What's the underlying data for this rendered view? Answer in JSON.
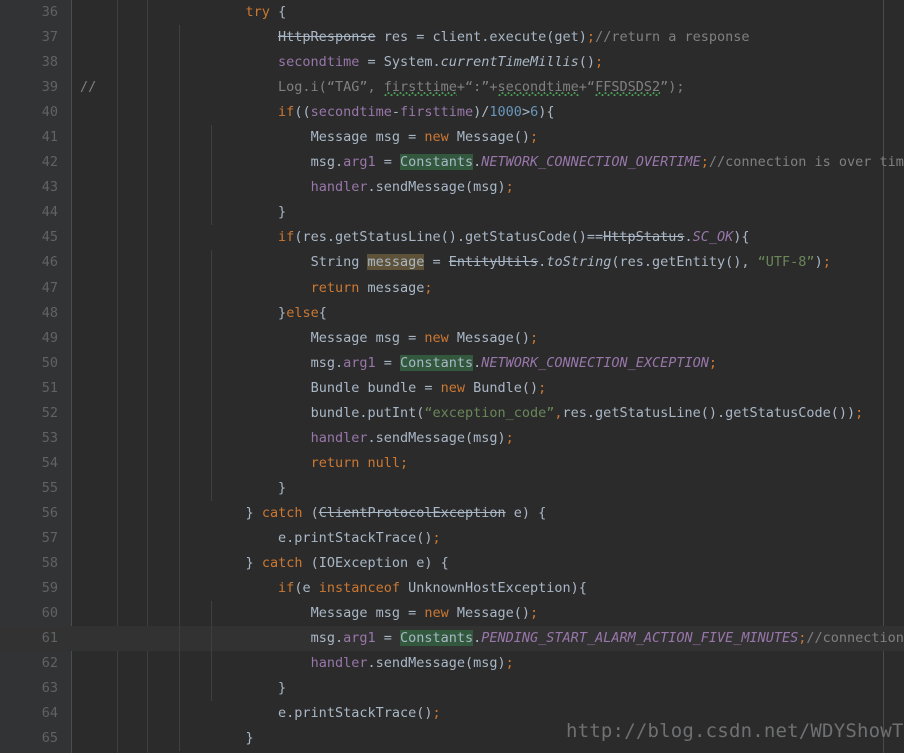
{
  "editor": {
    "theme": "darcula",
    "background": "#2b2b2b",
    "gutter_background": "#313335",
    "current_line_background": "#323232",
    "default_text_color": "#a9b7c6",
    "keyword_color": "#cc7832",
    "string_color": "#6a8759",
    "number_color": "#6897bb",
    "comment_color": "#808080",
    "field_color": "#9876aa",
    "line_number_color": "#606366",
    "find_highlight_color": "#32593d",
    "identifier_highlight_color": "#5e5339",
    "typo_underline_color": "#499c54",
    "current_line_number": 61,
    "language": "Java"
  },
  "watermark": {
    "text": "http://blog.csdn.net/WDYShowTime",
    "color": "#6f7072"
  },
  "lines": [
    {
      "n": "36",
      "gutter_mark": "",
      "indent_guides": [],
      "tokens": [
        {
          "t": "            ",
          "c": "plain"
        },
        {
          "t": "try",
          "c": "kw"
        },
        {
          "t": " {",
          "c": "plain"
        }
      ]
    },
    {
      "n": "37",
      "gutter_mark": "",
      "indent_guides": [
        0
      ],
      "tokens": [
        {
          "t": "                ",
          "c": "plain"
        },
        {
          "t": "HttpResponse",
          "c": "depr"
        },
        {
          "t": " res = client.execute(get)",
          "c": "plain"
        },
        {
          "t": ";",
          "c": "kw"
        },
        {
          "t": "//return a response",
          "c": "cmt"
        }
      ]
    },
    {
      "n": "38",
      "gutter_mark": "",
      "indent_guides": [
        0
      ],
      "tokens": [
        {
          "t": "                ",
          "c": "plain"
        },
        {
          "t": "secondtime",
          "c": "field"
        },
        {
          "t": " = System.",
          "c": "plain"
        },
        {
          "t": "currentTimeMillis",
          "c": "smeth"
        },
        {
          "t": "()",
          "c": "plain"
        },
        {
          "t": ";",
          "c": "kw"
        }
      ]
    },
    {
      "n": "39",
      "gutter_mark": "//",
      "indent_guides": [
        0
      ],
      "tokens": [
        {
          "t": "                ",
          "c": "plain"
        },
        {
          "t": "Log.i(“TAG”, ",
          "c": "cmt"
        },
        {
          "t": "firsttime",
          "c": "cmt typo"
        },
        {
          "t": "+“:”+",
          "c": "cmt"
        },
        {
          "t": "secondtime",
          "c": "cmt typo"
        },
        {
          "t": "+“",
          "c": "cmt"
        },
        {
          "t": "FFSDSDS2",
          "c": "cmt typo"
        },
        {
          "t": "”);",
          "c": "cmt"
        }
      ]
    },
    {
      "n": "40",
      "gutter_mark": "",
      "indent_guides": [
        0
      ],
      "tokens": [
        {
          "t": "                ",
          "c": "plain"
        },
        {
          "t": "if",
          "c": "kw"
        },
        {
          "t": "((",
          "c": "plain"
        },
        {
          "t": "secondtime",
          "c": "field"
        },
        {
          "t": "-",
          "c": "plain"
        },
        {
          "t": "firsttime",
          "c": "field"
        },
        {
          "t": ")/",
          "c": "plain"
        },
        {
          "t": "1000",
          "c": "num"
        },
        {
          "t": ">",
          "c": "plain"
        },
        {
          "t": "6",
          "c": "num"
        },
        {
          "t": "){",
          "c": "plain"
        }
      ]
    },
    {
      "n": "41",
      "gutter_mark": "",
      "indent_guides": [
        0,
        1
      ],
      "tokens": [
        {
          "t": "                    ",
          "c": "plain"
        },
        {
          "t": "Message msg = ",
          "c": "plain"
        },
        {
          "t": "new",
          "c": "kw"
        },
        {
          "t": " Message()",
          "c": "plain"
        },
        {
          "t": ";",
          "c": "kw"
        }
      ]
    },
    {
      "n": "42",
      "gutter_mark": "",
      "indent_guides": [
        0,
        1
      ],
      "tokens": [
        {
          "t": "                    ",
          "c": "plain"
        },
        {
          "t": "msg.",
          "c": "plain"
        },
        {
          "t": "arg1",
          "c": "field"
        },
        {
          "t": " = ",
          "c": "plain"
        },
        {
          "t": "Constants",
          "c": "plain hl-find"
        },
        {
          "t": ".",
          "c": "plain"
        },
        {
          "t": "NETWORK_CONNECTION_OVERTIME",
          "c": "cfield"
        },
        {
          "t": ";",
          "c": "kw"
        },
        {
          "t": "//connection is over time",
          "c": "cmt"
        }
      ]
    },
    {
      "n": "43",
      "gutter_mark": "",
      "indent_guides": [
        0,
        1
      ],
      "tokens": [
        {
          "t": "                    ",
          "c": "plain"
        },
        {
          "t": "handler",
          "c": "field"
        },
        {
          "t": ".sendMessage(msg)",
          "c": "plain"
        },
        {
          "t": ";",
          "c": "kw"
        }
      ]
    },
    {
      "n": "44",
      "gutter_mark": "",
      "indent_guides": [
        0,
        1
      ],
      "tokens": [
        {
          "t": "                ",
          "c": "plain"
        },
        {
          "t": "}",
          "c": "plain"
        }
      ]
    },
    {
      "n": "45",
      "gutter_mark": "",
      "indent_guides": [
        0
      ],
      "tokens": [
        {
          "t": "                ",
          "c": "plain"
        },
        {
          "t": "if",
          "c": "kw"
        },
        {
          "t": "(res.getStatusLine().getStatusCode()==",
          "c": "plain"
        },
        {
          "t": "HttpStatus",
          "c": "depr"
        },
        {
          "t": ".",
          "c": "plain"
        },
        {
          "t": "SC_OK",
          "c": "cfield"
        },
        {
          "t": "){",
          "c": "plain"
        }
      ]
    },
    {
      "n": "46",
      "gutter_mark": "",
      "indent_guides": [
        0,
        1
      ],
      "tokens": [
        {
          "t": "                    ",
          "c": "plain"
        },
        {
          "t": "String ",
          "c": "plain"
        },
        {
          "t": "message",
          "c": "plain hl-ident"
        },
        {
          "t": " = ",
          "c": "plain"
        },
        {
          "t": "EntityUtils",
          "c": "depr"
        },
        {
          "t": ".",
          "c": "plain"
        },
        {
          "t": "toString",
          "c": "smeth"
        },
        {
          "t": "(res.getEntity(), ",
          "c": "plain"
        },
        {
          "t": "“UTF-8”",
          "c": "str"
        },
        {
          "t": ")",
          "c": "plain"
        },
        {
          "t": ";",
          "c": "kw"
        }
      ]
    },
    {
      "n": "47",
      "gutter_mark": "",
      "indent_guides": [
        0,
        1
      ],
      "tokens": [
        {
          "t": "                    ",
          "c": "plain"
        },
        {
          "t": "return",
          "c": "kw"
        },
        {
          "t": " message",
          "c": "plain"
        },
        {
          "t": ";",
          "c": "kw"
        }
      ]
    },
    {
      "n": "48",
      "gutter_mark": "",
      "indent_guides": [
        0,
        1
      ],
      "tokens": [
        {
          "t": "                ",
          "c": "plain"
        },
        {
          "t": "}",
          "c": "plain"
        },
        {
          "t": "else",
          "c": "kw"
        },
        {
          "t": "{",
          "c": "plain"
        }
      ]
    },
    {
      "n": "49",
      "gutter_mark": "",
      "indent_guides": [
        0,
        1
      ],
      "tokens": [
        {
          "t": "                    ",
          "c": "plain"
        },
        {
          "t": "Message msg = ",
          "c": "plain"
        },
        {
          "t": "new",
          "c": "kw"
        },
        {
          "t": " Message()",
          "c": "plain"
        },
        {
          "t": ";",
          "c": "kw"
        }
      ]
    },
    {
      "n": "50",
      "gutter_mark": "",
      "indent_guides": [
        0,
        1
      ],
      "tokens": [
        {
          "t": "                    ",
          "c": "plain"
        },
        {
          "t": "msg.",
          "c": "plain"
        },
        {
          "t": "arg1",
          "c": "field"
        },
        {
          "t": " = ",
          "c": "plain"
        },
        {
          "t": "Constants",
          "c": "plain hl-find"
        },
        {
          "t": ".",
          "c": "plain"
        },
        {
          "t": "NETWORK_CONNECTION_EXCEPTION",
          "c": "cfield"
        },
        {
          "t": ";",
          "c": "kw"
        }
      ]
    },
    {
      "n": "51",
      "gutter_mark": "",
      "indent_guides": [
        0,
        1
      ],
      "tokens": [
        {
          "t": "                    ",
          "c": "plain"
        },
        {
          "t": "Bundle bundle = ",
          "c": "plain"
        },
        {
          "t": "new",
          "c": "kw"
        },
        {
          "t": " Bundle()",
          "c": "plain"
        },
        {
          "t": ";",
          "c": "kw"
        }
      ]
    },
    {
      "n": "52",
      "gutter_mark": "",
      "indent_guides": [
        0,
        1
      ],
      "tokens": [
        {
          "t": "                    ",
          "c": "plain"
        },
        {
          "t": "bundle.putInt(",
          "c": "plain"
        },
        {
          "t": "“exception_code”",
          "c": "str"
        },
        {
          "t": ",",
          "c": "kw"
        },
        {
          "t": "res.getStatusLine().getStatusCode())",
          "c": "plain"
        },
        {
          "t": ";",
          "c": "kw"
        }
      ]
    },
    {
      "n": "53",
      "gutter_mark": "",
      "indent_guides": [
        0,
        1
      ],
      "tokens": [
        {
          "t": "                    ",
          "c": "plain"
        },
        {
          "t": "handler",
          "c": "field"
        },
        {
          "t": ".sendMessage(msg)",
          "c": "plain"
        },
        {
          "t": ";",
          "c": "kw"
        }
      ]
    },
    {
      "n": "54",
      "gutter_mark": "",
      "indent_guides": [
        0,
        1
      ],
      "tokens": [
        {
          "t": "                    ",
          "c": "plain"
        },
        {
          "t": "return",
          "c": "kw"
        },
        {
          "t": " ",
          "c": "plain"
        },
        {
          "t": "null",
          "c": "kw"
        },
        {
          "t": ";",
          "c": "kw"
        }
      ]
    },
    {
      "n": "55",
      "gutter_mark": "",
      "indent_guides": [
        0,
        1
      ],
      "tokens": [
        {
          "t": "                ",
          "c": "plain"
        },
        {
          "t": "}",
          "c": "plain"
        }
      ]
    },
    {
      "n": "56",
      "gutter_mark": "",
      "indent_guides": [
        0
      ],
      "tokens": [
        {
          "t": "            ",
          "c": "plain"
        },
        {
          "t": "}",
          "c": "plain"
        },
        {
          "t": " ",
          "c": "plain"
        },
        {
          "t": "catch",
          "c": "kw"
        },
        {
          "t": " (",
          "c": "plain"
        },
        {
          "t": "ClientProtocolException",
          "c": "depr"
        },
        {
          "t": " e) {",
          "c": "plain"
        }
      ]
    },
    {
      "n": "57",
      "gutter_mark": "",
      "indent_guides": [
        0
      ],
      "tokens": [
        {
          "t": "                ",
          "c": "plain"
        },
        {
          "t": "e.printStackTrace()",
          "c": "plain"
        },
        {
          "t": ";",
          "c": "kw"
        }
      ]
    },
    {
      "n": "58",
      "gutter_mark": "",
      "indent_guides": [
        0
      ],
      "tokens": [
        {
          "t": "            ",
          "c": "plain"
        },
        {
          "t": "}",
          "c": "plain"
        },
        {
          "t": " ",
          "c": "plain"
        },
        {
          "t": "catch",
          "c": "kw"
        },
        {
          "t": " (IOException e) {",
          "c": "plain"
        }
      ]
    },
    {
      "n": "59",
      "gutter_mark": "",
      "indent_guides": [
        0
      ],
      "tokens": [
        {
          "t": "                ",
          "c": "plain"
        },
        {
          "t": "if",
          "c": "kw"
        },
        {
          "t": "(e ",
          "c": "plain"
        },
        {
          "t": "instanceof",
          "c": "kw"
        },
        {
          "t": " UnknownHostException){",
          "c": "plain"
        }
      ]
    },
    {
      "n": "60",
      "gutter_mark": "",
      "indent_guides": [
        0,
        1
      ],
      "tokens": [
        {
          "t": "                    ",
          "c": "plain"
        },
        {
          "t": "Message msg = ",
          "c": "plain"
        },
        {
          "t": "new",
          "c": "kw"
        },
        {
          "t": " Message()",
          "c": "plain"
        },
        {
          "t": ";",
          "c": "kw"
        }
      ]
    },
    {
      "n": "61",
      "gutter_mark": "",
      "current": true,
      "indent_guides": [
        0,
        1
      ],
      "tokens": [
        {
          "t": "                    ",
          "c": "plain"
        },
        {
          "t": "msg.",
          "c": "plain"
        },
        {
          "t": "arg1",
          "c": "field"
        },
        {
          "t": " = ",
          "c": "plain"
        },
        {
          "t": "Constants",
          "c": "plain hl-find"
        },
        {
          "t": ".",
          "c": "plain"
        },
        {
          "t": "PENDING_START_ALARM_ACTION_FIVE_MINUTES",
          "c": "cfield"
        },
        {
          "t": ";",
          "c": "kw"
        },
        {
          "t": "//connection is over time",
          "c": "cmt"
        }
      ]
    },
    {
      "n": "62",
      "gutter_mark": "",
      "indent_guides": [
        0,
        1
      ],
      "tokens": [
        {
          "t": "                    ",
          "c": "plain"
        },
        {
          "t": "handler",
          "c": "field"
        },
        {
          "t": ".sendMessage(msg)",
          "c": "plain"
        },
        {
          "t": ";",
          "c": "kw"
        }
      ]
    },
    {
      "n": "63",
      "gutter_mark": "",
      "indent_guides": [
        0,
        1
      ],
      "tokens": [
        {
          "t": "                ",
          "c": "plain"
        },
        {
          "t": "}",
          "c": "plain"
        }
      ]
    },
    {
      "n": "64",
      "gutter_mark": "",
      "indent_guides": [
        0
      ],
      "tokens": [
        {
          "t": "                ",
          "c": "plain"
        },
        {
          "t": "e.printStackTrace()",
          "c": "plain"
        },
        {
          "t": ";",
          "c": "kw"
        }
      ]
    },
    {
      "n": "65",
      "gutter_mark": "",
      "indent_guides": [
        0
      ],
      "tokens": [
        {
          "t": "            ",
          "c": "plain"
        },
        {
          "t": "}",
          "c": "plain"
        }
      ]
    }
  ]
}
